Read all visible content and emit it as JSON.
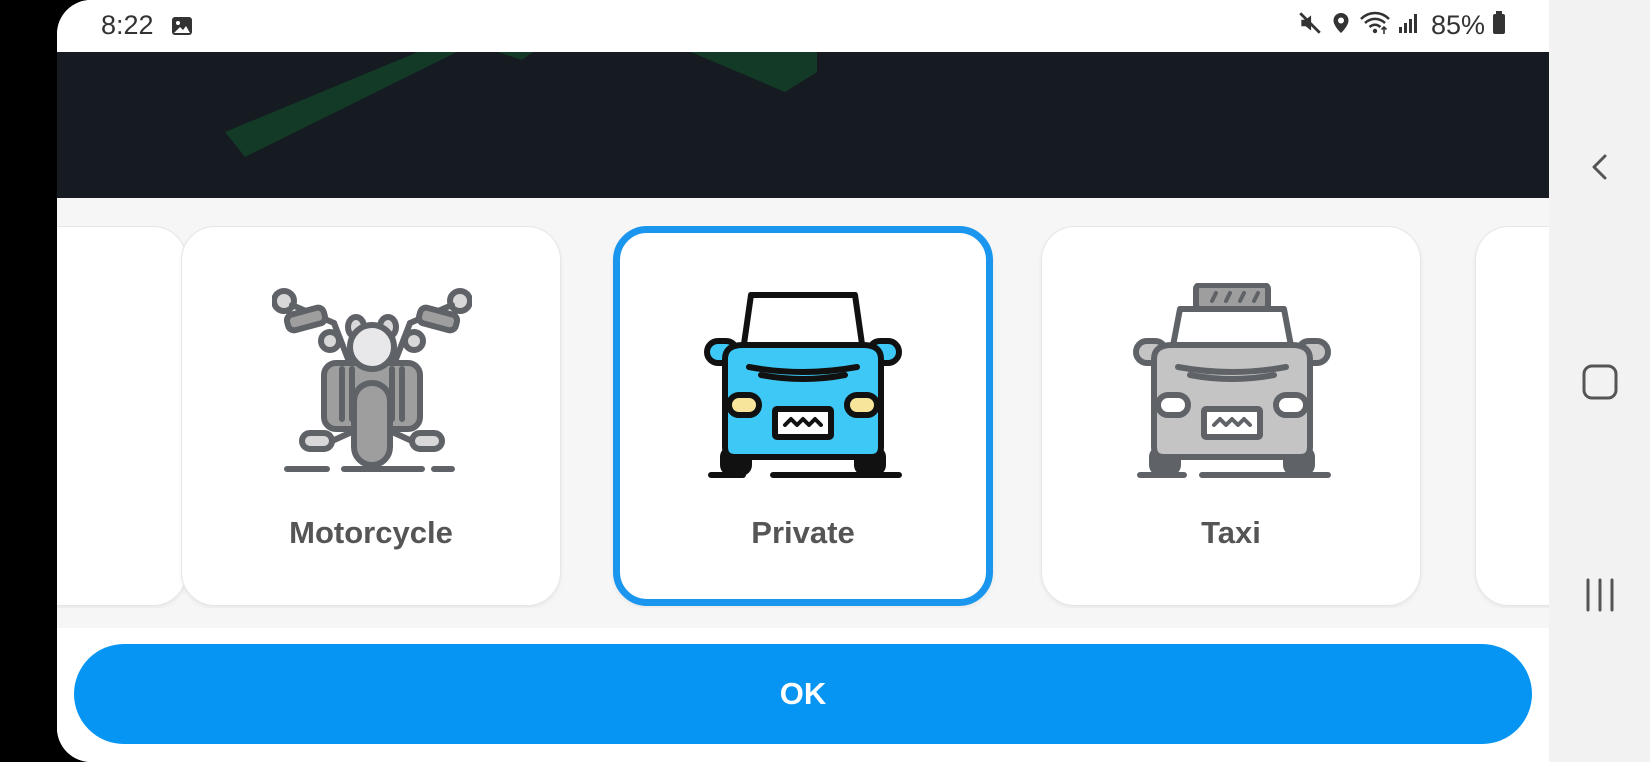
{
  "status_bar": {
    "time": "8:22",
    "battery": "85%",
    "icons": [
      "gallery-icon",
      "mute-icon",
      "location-icon",
      "wifi-icon",
      "signal-icon",
      "battery-icon"
    ]
  },
  "vehicles": [
    {
      "label": "",
      "icon": "partial-card",
      "selected": false
    },
    {
      "label": "Motorcycle",
      "icon": "motorcycle-icon",
      "selected": false
    },
    {
      "label": "Private",
      "icon": "car-icon",
      "selected": true
    },
    {
      "label": "Taxi",
      "icon": "taxi-icon",
      "selected": false
    },
    {
      "label": "",
      "icon": "partial-card",
      "selected": false
    }
  ],
  "ok_button": {
    "label": "OK"
  },
  "colors": {
    "accent": "#0795f4",
    "selected_border": "#1a96ef",
    "map_background": "#161a21",
    "map_road": "#123a26",
    "car_body": "#3dc8f5",
    "car_headlight": "#f6e59a",
    "icon_gray": "#5f6368"
  },
  "nav_bar": {
    "icons": [
      "back-icon",
      "home-icon",
      "recents-icon"
    ]
  }
}
